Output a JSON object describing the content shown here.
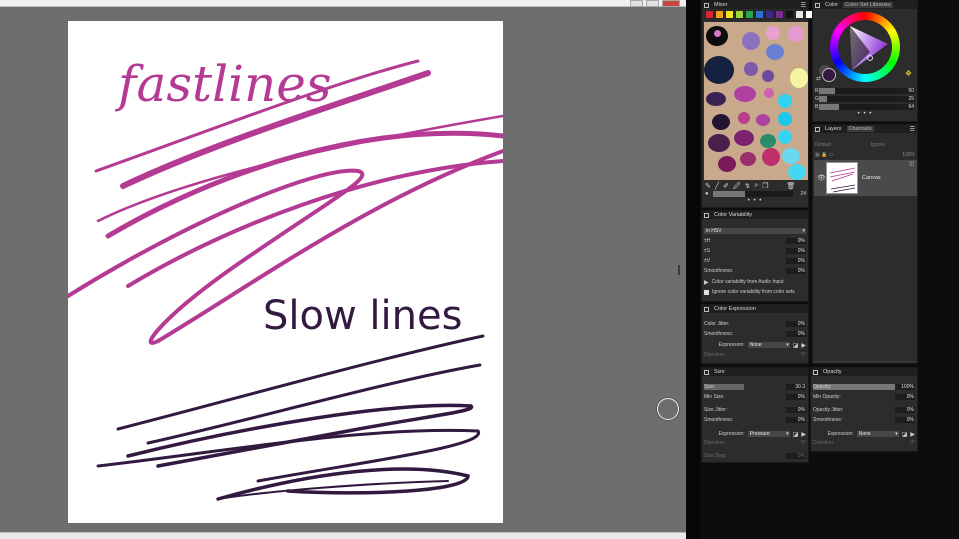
{
  "canvas": {
    "text_fast": "fastlines",
    "text_slow": "Slow lines"
  },
  "mixer": {
    "title": "Mixer",
    "palette_colors": [
      "#d9262e",
      "#f2a01c",
      "#f6e320",
      "#9bd43c",
      "#2aa548",
      "#2e6fd0",
      "#3a2b8c",
      "#7a2b8c",
      "#111111",
      "#e8e8e8",
      "#ffffff"
    ],
    "brush_size_value": "24",
    "more": "• • •"
  },
  "color_panel": {
    "title": "Color",
    "tab_sets": "Color Set Libraries",
    "r_label": "R",
    "r_value": "50",
    "g_label": "G",
    "g_value": "25",
    "b_label": "B",
    "b_value": "64",
    "more": "• • •",
    "selected_color": "#32193f"
  },
  "layers_panel": {
    "tab_layers": "Layers",
    "tab_channels": "Channels",
    "blend_mode": "Default",
    "ignore_label": "Ignore",
    "opacity": "100%",
    "layer_name": "Canvas"
  },
  "color_variability": {
    "title": "Color Variability",
    "mode": "in HSV",
    "h_label": "±H",
    "h_value": "0%",
    "s_label": "±S",
    "s_value": "0%",
    "v_label": "±V",
    "v_value": "0%",
    "smooth_label": "Smoothness:",
    "smooth_value": "0%",
    "audio_label": "Color variability from Audio Input",
    "ignore_sets_label": "Ignore color variability from color sets"
  },
  "color_expression": {
    "title": "Color Expression",
    "jitter_label": "Color Jitter:",
    "jitter_value": "0%",
    "smooth_label": "Smoothness:",
    "smooth_value": "0%",
    "expression_label": "Expression:",
    "expression_value": "None",
    "direction_label": "Direction:",
    "direction_value": "0°"
  },
  "size_panel": {
    "title": "Size",
    "size_label": "Size:",
    "size_value": "30.3",
    "min_label": "Min Size:",
    "min_value": "0%",
    "jitter_label": "Size Jitter:",
    "jitter_value": "0%",
    "smooth_label": "Smoothness:",
    "smooth_value": "0%",
    "expression_label": "Expression:",
    "expression_value": "Pressure",
    "direction_label": "Direction:",
    "direction_value": "0°",
    "step_label": "Size Step:",
    "step_value": "0%"
  },
  "opacity_panel": {
    "title": "Opacity",
    "opacity_label": "Opacity:",
    "opacity_value": "100%",
    "min_label": "Min Opacity:",
    "min_value": "0%",
    "jitter_label": "Opacity Jitter:",
    "jitter_value": "0%",
    "smooth_label": "Smoothness:",
    "smooth_value": "0%",
    "expression_label": "Expression:",
    "expression_value": "None",
    "direction_label": "Direction:",
    "direction_value": "0°"
  }
}
